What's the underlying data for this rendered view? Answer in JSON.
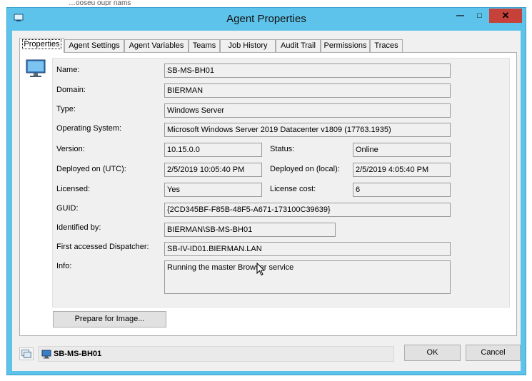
{
  "background_text": "…ooseu oupr nams",
  "window": {
    "title": "Agent Properties",
    "minimize_label": "—",
    "maximize_label": "□",
    "close_label": "✕"
  },
  "tabs": [
    {
      "label": "Properties",
      "active": true
    },
    {
      "label": "Agent Settings"
    },
    {
      "label": "Agent Variables"
    },
    {
      "label": "Teams"
    },
    {
      "label": "Job History"
    },
    {
      "label": "Audit Trail"
    },
    {
      "label": "Permissions"
    },
    {
      "label": "Traces"
    }
  ],
  "form": {
    "name": {
      "label": "Name:",
      "value": "SB-MS-BH01"
    },
    "domain": {
      "label": "Domain:",
      "value": "BIERMAN"
    },
    "type": {
      "label": "Type:",
      "value": "Windows Server"
    },
    "os": {
      "label": "Operating System:",
      "value": "Microsoft Windows Server 2019 Datacenter v1809 (17763.1935)"
    },
    "version": {
      "label": "Version:",
      "value": "10.15.0.0"
    },
    "status": {
      "label": "Status:",
      "value": "Online"
    },
    "deployed_utc": {
      "label": "Deployed on (UTC):",
      "value": "2/5/2019 10:05:40 PM"
    },
    "deployed_local": {
      "label": "Deployed on (local):",
      "value": "2/5/2019 4:05:40 PM"
    },
    "licensed": {
      "label": "Licensed:",
      "value": "Yes"
    },
    "license_cost": {
      "label": "License cost:",
      "value": "6"
    },
    "guid": {
      "label": "GUID:",
      "value": "{2CD345BF-F85B-48F5-A671-173100C39639}"
    },
    "identified_by": {
      "label": "Identified by:",
      "value": "BIERMAN\\SB-MS-BH01"
    },
    "first_dispatcher": {
      "label": "First accessed Dispatcher:",
      "value": "SB-IV-ID01.BIERMAN.LAN"
    },
    "info": {
      "label": "Info:",
      "value": "Running the master Browser service"
    }
  },
  "prepare_button": "Prepare for Image...",
  "status_bar": {
    "agent": "SB-MS-BH01"
  },
  "ok_button": "OK",
  "cancel_button": "Cancel",
  "colors": {
    "titlebar": "#5ec3ea",
    "close": "#c7413b",
    "surface": "#f0f0f0"
  },
  "icons": [
    "computer-monitor-icon",
    "window-app-icon",
    "agent-list-icon",
    "mouse-cursor-icon"
  ]
}
